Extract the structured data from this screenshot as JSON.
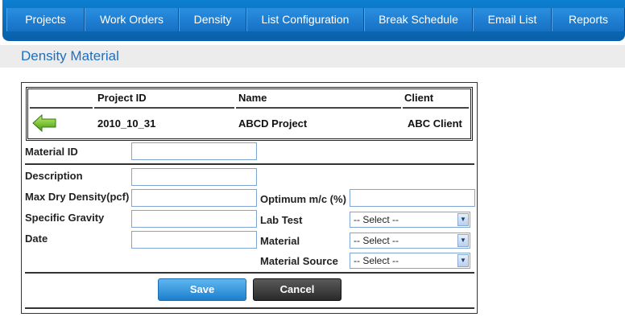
{
  "nav": {
    "items": [
      {
        "label": "Projects"
      },
      {
        "label": "Work Orders"
      },
      {
        "label": "Density"
      },
      {
        "label": "List Configuration"
      },
      {
        "label": "Break Schedule"
      },
      {
        "label": "Email List"
      },
      {
        "label": "Reports"
      }
    ]
  },
  "page": {
    "title": "Density Material"
  },
  "project": {
    "headers": {
      "project_id": "Project ID",
      "name": "Name",
      "client": "Client"
    },
    "values": {
      "project_id": "2010_10_31",
      "name": "ABCD Project",
      "client": "ABC Client"
    },
    "back_icon": "green-left-arrow"
  },
  "form": {
    "material_id_label": "Material ID",
    "description_label": "Description",
    "max_dry_density_label": "Max Dry Density(pcf)",
    "specific_gravity_label": "Specific Gravity",
    "date_label": "Date",
    "optimum_mc_label": "Optimum m/c (%)",
    "lab_test_label": "Lab Test",
    "material_label": "Material",
    "material_source_label": "Material Source",
    "lab_test_value": "-- Select --",
    "material_value": "-- Select --",
    "material_source_value": "-- Select --"
  },
  "buttons": {
    "save": "Save",
    "cancel": "Cancel"
  },
  "colors": {
    "nav": "#0a6cc0",
    "title": "#1d6fbf",
    "save": "#1c7fcc",
    "cancel": "#2a2a2a"
  }
}
